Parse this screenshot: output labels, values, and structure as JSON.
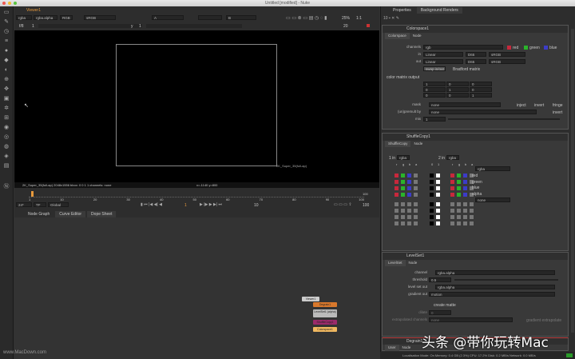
{
  "window": {
    "title": "Untitled [modified] - Nuke"
  },
  "viewer": {
    "tab": "Viewer1",
    "channels": "rgba",
    "layer": "rgba.alpha",
    "display": "RGB",
    "lut": "sRGB",
    "a_input": "A",
    "b_input": "B",
    "gain_label": "f/8",
    "gain_value": "1",
    "gamma_label": "y",
    "gamma_value": "1",
    "zoom_pct": "25%",
    "ratio": "1:1",
    "frame_field": "20",
    "format_info": "2K_Super_35(full-ap) 2048x1556  bbox: 0 0 1 1 channels: none",
    "coords": "x=-1140 y=800",
    "format_label": "2K_Super_35(full-ap)"
  },
  "timeline": {
    "ticks": [
      "1",
      "10",
      "20",
      "30",
      "40",
      "50",
      "60",
      "70",
      "80",
      "90",
      "100"
    ],
    "start": "1",
    "end": "100",
    "fps": "24*",
    "tf": "TF",
    "scope": "Global",
    "current_frame": "1",
    "step": "10",
    "out_value": "100"
  },
  "lower_tabs": [
    "Node Graph",
    "Curve Editor",
    "Dope Sheet"
  ],
  "nodes": [
    "Viewer1",
    "Degrain1",
    "LevelSet1 (alpha)",
    "ShuffleCopy1",
    "Colorspace1"
  ],
  "properties": {
    "tabs": [
      "Properties",
      "Background Renders"
    ],
    "colorspace": {
      "title": "Colorspace1",
      "tabs": [
        "Colorspace",
        "Node"
      ],
      "channels_label": "channels",
      "channels": "rgb",
      "red": "red",
      "green": "green",
      "blue": "blue",
      "in_label": "in",
      "in": [
        "Linear",
        "D65",
        "sRGB"
      ],
      "out_label": "out",
      "out": [
        "Linear",
        "D65",
        "sRGB"
      ],
      "swap": "swap in/out",
      "bradford": "Bradford matrix",
      "matrix_label": "color matrix output",
      "matrix": [
        "1",
        "0",
        "0",
        "0",
        "1",
        "0",
        "0",
        "0",
        "1"
      ],
      "mask_label": "mask",
      "mask": "none",
      "inject": "inject",
      "invert": "invert",
      "fringe": "fringe",
      "premult_label": "(un)premult by",
      "premult": "none",
      "invert2": "invert",
      "mix_label": "mix",
      "mix": "1"
    },
    "shuffle": {
      "title": "ShuffleCopy1",
      "tabs": [
        "ShuffleCopy",
        "Node"
      ],
      "in1_label": "1 in",
      "in1": "rgba",
      "in2_label": "2 in",
      "in2": "rgba",
      "cols1": [
        "r",
        "g",
        "b",
        "a"
      ],
      "cols_mid": [
        "0",
        "1"
      ],
      "cols2": [
        "r",
        "g",
        "b",
        "a"
      ],
      "out1": "rgba",
      "out2": "none",
      "outputs": [
        "red",
        "green",
        "blue",
        "alpha"
      ]
    },
    "levelset": {
      "title": "LevelSet1",
      "tabs": [
        "LevelSet",
        "Node"
      ],
      "channel_label": "channel",
      "channel": "rgba.alpha",
      "threshold_label": "threshold",
      "threshold": "0.5",
      "lso_label": "level set out",
      "lso": "rgba.alpha",
      "grad_label": "gradient out",
      "grad": "motion",
      "create_matte": "create matte",
      "dilate_label": "dilate",
      "dilate": "0",
      "extrap_label": "extrapolated channels",
      "extrap": "none",
      "grad_extrap": "gradient extrapolate"
    },
    "degrain": {
      "title": "Degrain1",
      "tabs": [
        "User",
        "Node"
      ]
    }
  },
  "status": "Localisation Mode: On  Memory: 0.4 GB (2.3%)  CPU: 17.2%  Disk: 0.2 MB/s  Network: 0.0 MB/s",
  "watermark_left": "www.MacDown.com",
  "watermark_right": "头条 @带你玩转Mac",
  "colors": {
    "accent": "#e89a3c",
    "red": "#c8283c",
    "green": "#2ab42a",
    "blue": "#3c3cc8"
  }
}
